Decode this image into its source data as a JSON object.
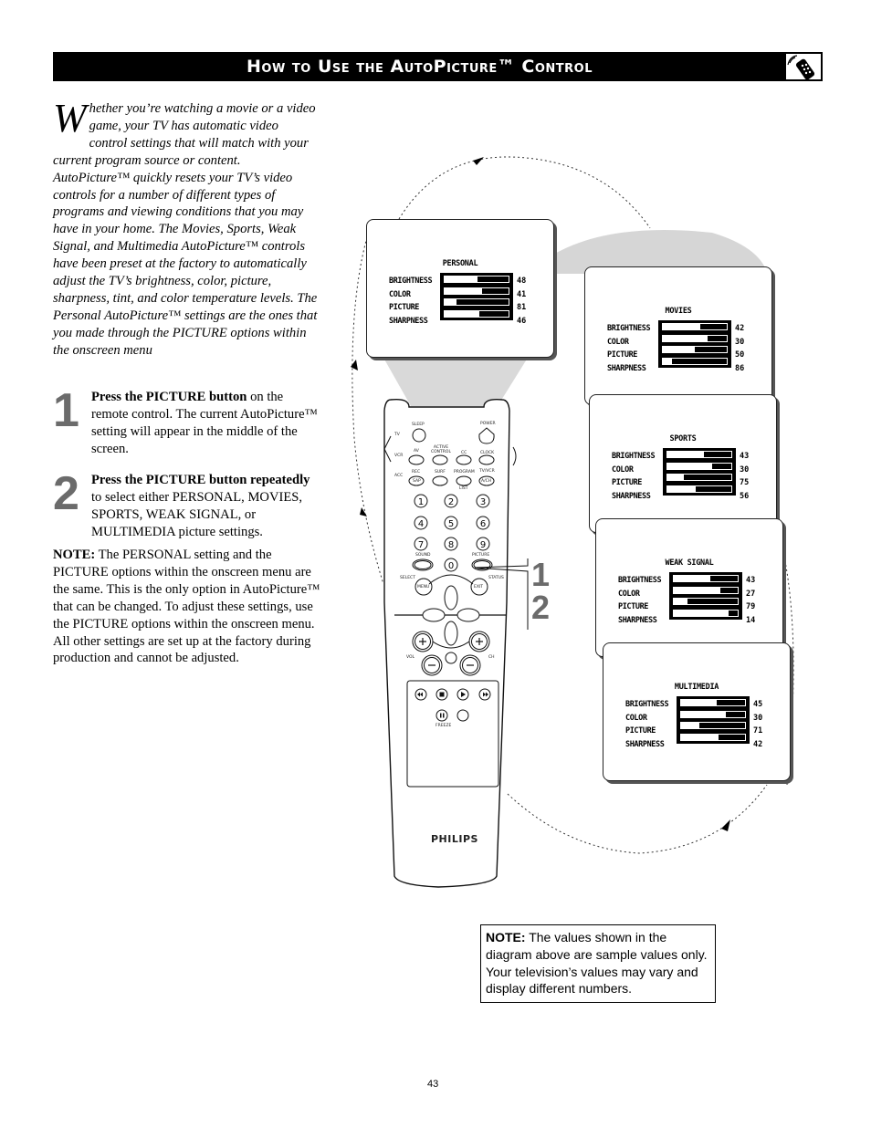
{
  "header": {
    "title": "How to Use the AutoPicture™ Control",
    "icon": "remote-control-icon"
  },
  "intro": {
    "dropcap": "W",
    "text": "hether you’re watching a movie or a video game, your TV has automatic video control settings that will match with your current program source or content. AutoPicture™ quickly resets your TV’s video controls for a number of different types of programs and viewing conditions that you may have in your home.  The Movies, Sports, Weak Signal, and Multimedia AutoPicture™ controls have been preset at the factory to automatically adjust the TV’s brightness, color, picture, sharpness, tint, and color temperature levels.  The Personal AutoPicture™ settings are the ones that you made through the PICTURE options within the onscreen menu"
  },
  "steps": [
    {
      "number": "1",
      "bold": "Press the PICTURE button",
      "text": " on the remote control.  The current AutoPicture™ setting will appear in the middle of the screen."
    },
    {
      "number": "2",
      "bold": "Press the PICTURE button repeatedly",
      "text": " to select either PERSONAL, MOVIES, SPORTS, WEAK SIGNAL, or MULTIMEDIA picture settings."
    }
  ],
  "note1": {
    "label": "NOTE:",
    "text": "  The PERSONAL setting and the PICTURE options within the onscreen menu are the same.  This is the only option in AutoPicture™ that can be changed.  To adjust these settings, use the PICTURE options within the onscreen menu.  All other settings are set up at the factory during production and cannot be adjusted."
  },
  "osd_labels": [
    "BRIGHTNESS",
    "COLOR",
    "PICTURE",
    "SHARPNESS"
  ],
  "osd_screens": [
    {
      "name": "PERSONAL",
      "values": [
        48,
        41,
        81,
        46
      ]
    },
    {
      "name": "MOVIES",
      "values": [
        42,
        30,
        50,
        86
      ]
    },
    {
      "name": "SPORTS",
      "values": [
        43,
        30,
        75,
        56
      ]
    },
    {
      "name": "WEAK SIGNAL",
      "values": [
        43,
        27,
        79,
        14
      ]
    },
    {
      "name": "MULTIMEDIA",
      "values": [
        45,
        30,
        71,
        42
      ]
    }
  ],
  "remote": {
    "brand": "PHILIPS",
    "mode_labels": [
      "TV",
      "VCR",
      "ACC"
    ],
    "buttons": [
      "SLEEP",
      "POWER",
      "AV",
      "ACTIVE CONTROL",
      "CC",
      "CLOCK",
      "REC",
      "SAP",
      "SURF",
      "PROGRAM",
      "LIST",
      "TV/VCR",
      "A/CH",
      "SOUND",
      "PICTURE",
      "SELECT",
      "MENU",
      "EXIT",
      "STATUS",
      "VOL",
      "CH",
      "FREEZE"
    ],
    "digits": [
      "1",
      "2",
      "3",
      "4",
      "5",
      "6",
      "7",
      "8",
      "9",
      "0"
    ],
    "step_callout": [
      "1",
      "2"
    ]
  },
  "note2": {
    "label": "NOTE:",
    "text": " The values shown in the diagram above are sample values only. Your television’s values may vary and display different numbers."
  },
  "page_number": "43"
}
